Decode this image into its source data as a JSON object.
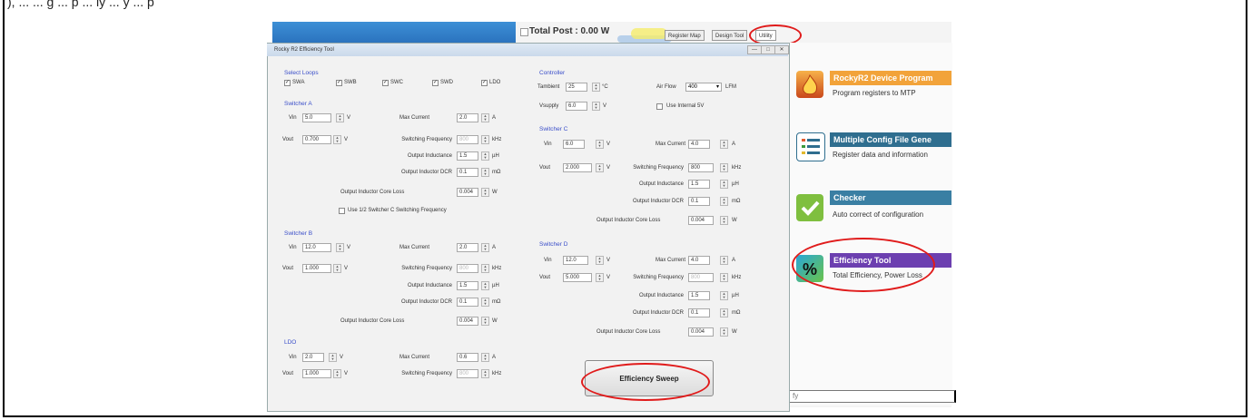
{
  "top_text": "), ... ... g ... p ... ly ... y ... p",
  "app": {
    "total_post": "Total Post : 0.00 W",
    "tabs": [
      "Register Map",
      "Design Tool",
      "Utility"
    ],
    "features": [
      {
        "title": "RockyR2 Device Program",
        "desc": "Program registers to MTP",
        "color": "#f2a33a",
        "icon": "flame-icon"
      },
      {
        "title": "Multiple Config File Gene",
        "desc": "Register data and information",
        "color": "#2f6e8f",
        "icon": "list-icon"
      },
      {
        "title": "Checker",
        "desc": "Auto correct of configuration",
        "color": "#3a7fa3",
        "icon": "checkmark-icon"
      },
      {
        "title": "Efficiency Tool",
        "desc": "Total Efficiency, Power Loss",
        "color": "#6c3fb0",
        "icon": "percent-icon"
      }
    ],
    "bottom_field": "fy"
  },
  "dialog": {
    "title": "Rocky R2 Efficiency Tool",
    "controls": [
      "—",
      "□",
      "✕"
    ],
    "select_loops_label": "Select Loops",
    "loops": [
      "SWA",
      "SWB",
      "SWC",
      "SWD",
      "LDO"
    ],
    "labels": {
      "vin": "Vin",
      "vout": "Vout",
      "max_current": "Max Current",
      "switching_frequency": "Switching Frequency",
      "output_inductance": "Output Inductance",
      "output_inductor_dcr": "Output Inductor DCR",
      "output_inductor_core_loss": "Output Inductor Core Loss",
      "use_half_swc": "Use 1/2 Switcher C Switching Frequency"
    },
    "units": {
      "v": "V",
      "a": "A",
      "khz": "kHz",
      "uh": "µH",
      "mohm": "mΩ",
      "w": "W",
      "c": "°C",
      "lfm": "LFM"
    },
    "switcher_a": {
      "title": "Switcher A",
      "vin": "5.0",
      "vout": "0.700",
      "max_current": "2.0",
      "freq": "800",
      "inductance": "1.5",
      "dcr": "0.1",
      "core_loss": "0.004"
    },
    "switcher_b": {
      "title": "Switcher B",
      "vin": "12.0",
      "vout": "1.000",
      "max_current": "2.0",
      "freq": "800",
      "inductance": "1.5",
      "dcr": "0.1",
      "core_loss": "0.004"
    },
    "ldo": {
      "title": "LDO",
      "vin": "2.0",
      "vout": "1.000",
      "max_current": "0.6",
      "freq": "800"
    },
    "controller": {
      "title": "Controller",
      "tambient_label": "Tambient",
      "tambient": "25",
      "airflow_label": "Air Flow",
      "airflow": "400",
      "vsupply_label": "Vsupply",
      "vsupply": "6.0",
      "internal5v_label": "Use Internal 5V"
    },
    "switcher_c": {
      "title": "Switcher C",
      "vin": "6.0",
      "vout": "2.000",
      "max_current": "4.0",
      "freq": "800",
      "inductance": "1.5",
      "dcr": "0.1",
      "core_loss": "0.004"
    },
    "switcher_d": {
      "title": "Switcher D",
      "vin": "12.0",
      "vout": "5.000",
      "max_current": "4.0",
      "freq": "800",
      "inductance": "1.5",
      "dcr": "0.1",
      "core_loss": "0.004"
    },
    "sweep_button": "Efficiency Sweep"
  },
  "colors": {
    "highlight": "#e01b1b",
    "section_title": "#3a4ec9"
  }
}
